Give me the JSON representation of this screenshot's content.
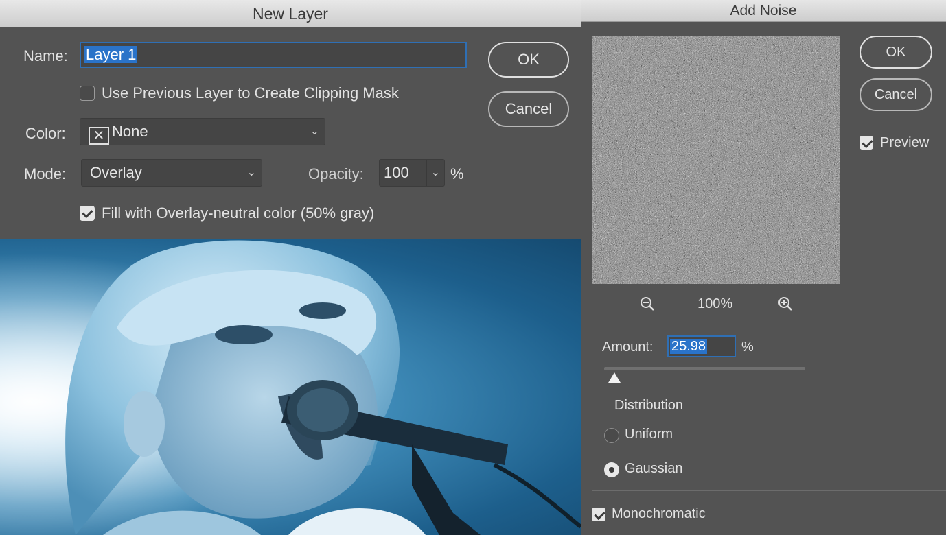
{
  "new_layer": {
    "title": "New Layer",
    "name_label": "Name:",
    "name_value": "Layer 1",
    "clip_label": "Use Previous Layer to Create Clipping Mask",
    "clip_checked": false,
    "color_label": "Color:",
    "color_value": "None",
    "mode_label": "Mode:",
    "mode_value": "Overlay",
    "opacity_label": "Opacity:",
    "opacity_value": "100",
    "opacity_unit": "%",
    "fill_label": "Fill with Overlay-neutral color (50% gray)",
    "fill_checked": true,
    "ok_label": "OK",
    "cancel_label": "Cancel"
  },
  "add_noise": {
    "title": "Add Noise",
    "ok_label": "OK",
    "cancel_label": "Cancel",
    "preview_label": "Preview",
    "preview_checked": true,
    "zoom_level": "100%",
    "amount_label": "Amount:",
    "amount_value": "25.98",
    "amount_unit": "%",
    "distribution_label": "Distribution",
    "uniform_label": "Uniform",
    "gaussian_label": "Gaussian",
    "selected_distribution": "Gaussian",
    "monochromatic_label": "Monochromatic",
    "monochromatic_checked": true
  },
  "colors": {
    "dialog_bg": "#535353",
    "field_bg": "#454545",
    "selection_blue": "#2a73c9",
    "focus_ring": "#2f6fb4"
  },
  "icons": [
    "checkbox-icon",
    "x-swatch-icon",
    "chevron-down-icon",
    "zoom-out-icon",
    "zoom-in-icon",
    "radio-icon"
  ]
}
